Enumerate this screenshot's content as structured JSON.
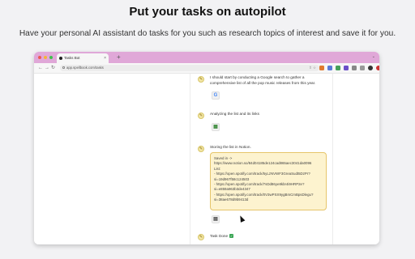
{
  "hero": {
    "title": "Put your tasks on autopilot",
    "subtitle": "Have your personal AI assistant do tasks for you such as research topics of interest and save it for you."
  },
  "browser": {
    "tab_title": "Tasks Bot",
    "tab_close": "×",
    "new_tab": "+",
    "tab_menu": "⌄",
    "url": "app.spellbook.com/tasks",
    "nav": {
      "back": "←",
      "forward": "→",
      "reload": "↻"
    },
    "url_actions": "⇧ ☆",
    "colors": {
      "tabbar": "#e0a8d8",
      "close": "#ee5a52",
      "minimize": "#f4b534",
      "maximize": "#3fc04e"
    }
  },
  "steps": [
    {
      "icon": "✎",
      "lines": [
        "I should start by conducting a Google search to gather a",
        "comprehensive list of all the pop music releases from this year."
      ],
      "tool": "G"
    },
    {
      "icon": "✎",
      "lines": [
        "Analyzing the list and its links"
      ],
      "tool": "▦"
    },
    {
      "icon": "✎",
      "lines": [
        "Storing the list in Notion."
      ],
      "tool": "▤"
    },
    {
      "icon": "✎",
      "lines": [
        "Task Done"
      ]
    }
  ],
  "result": {
    "lines": [
      "Saved in ->",
      "https://www.notion.so/84d04185de124cad865aec3041da0096",
      "List:",
      "- https://open.spotify.com/track/5yLzNVWF3GreaSudt5DzPr?",
      "si=19d967f58c124503",
      "- https://open.spotify.com/track/7sDd86ye8kbr4i9HRP2e?",
      "si=e859a963b3de4347",
      "- https://open.spotify.com/track/0V3wPSX9ygBmCmBpsDlegu?",
      "si=38ae678d9b9413d"
    ]
  }
}
